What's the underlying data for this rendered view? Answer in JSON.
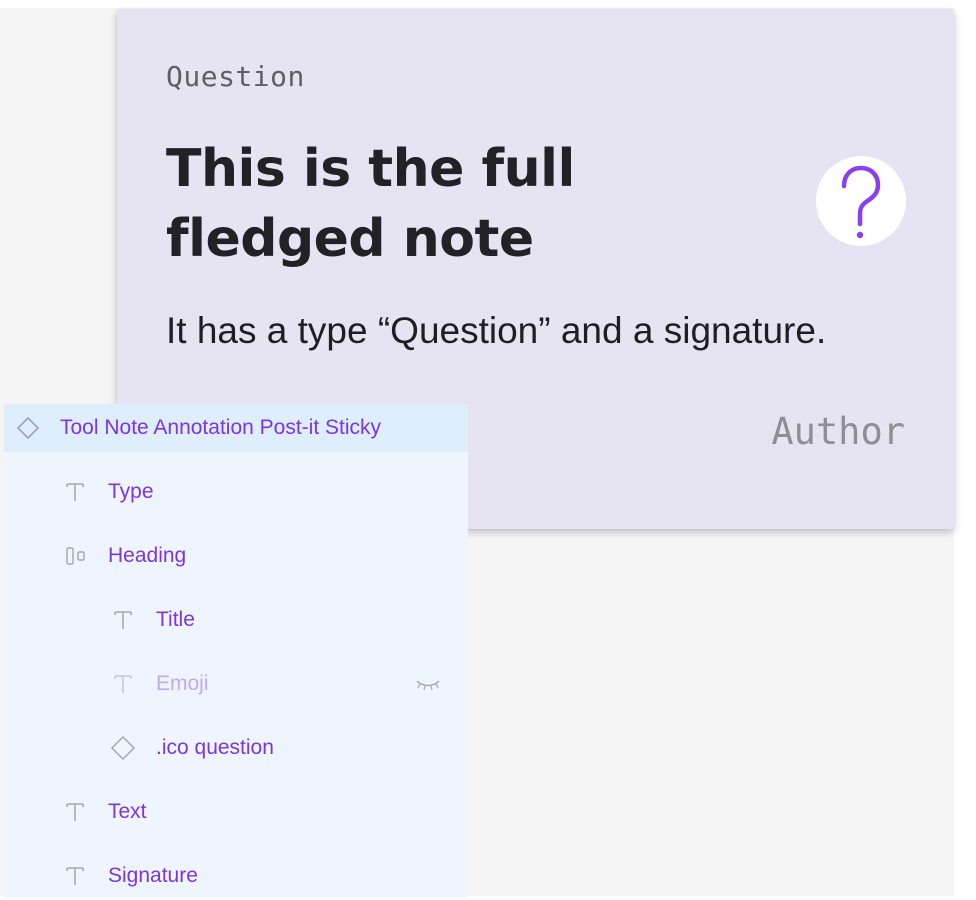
{
  "note": {
    "type": "Question",
    "title": "This is the full fledged note",
    "emoji_icon": "question-mark-icon",
    "text": "It has a type “Question” and a signature.",
    "signature": "Author"
  },
  "layers": {
    "items": [
      {
        "label": "Tool Note Annotation Post-it Sticky",
        "icon": "component-icon",
        "depth": 0,
        "selected": true
      },
      {
        "label": "Type",
        "icon": "text-icon",
        "depth": 1
      },
      {
        "label": "Heading",
        "icon": "auto-layout-icon",
        "depth": 1
      },
      {
        "label": "Title",
        "icon": "text-icon",
        "depth": 2
      },
      {
        "label": "Emoji",
        "icon": "text-icon",
        "depth": 2,
        "hidden": true,
        "visibility_icon": "eye-closed-icon"
      },
      {
        "label": ".ico question",
        "icon": "instance-icon",
        "depth": 2
      },
      {
        "label": "Text",
        "icon": "text-icon",
        "depth": 1
      },
      {
        "label": "Signature",
        "icon": "text-icon",
        "depth": 1
      }
    ]
  },
  "colors": {
    "note_background": "#e6e4f3",
    "accent_purple": "#7b35e3",
    "panel_background": "#eff5ff",
    "selected_row": "#dfeefd",
    "icon_gray": "#a8a8b4"
  }
}
